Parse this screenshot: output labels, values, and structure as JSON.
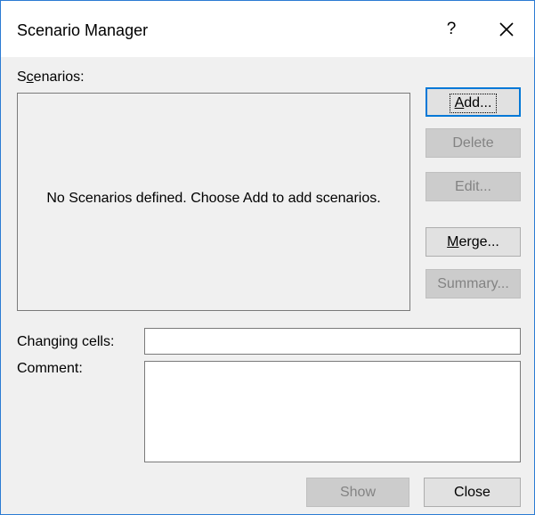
{
  "window": {
    "title": "Scenario Manager",
    "help_label": "?",
    "close_icon": "close-icon"
  },
  "scenarios": {
    "label_before": "S",
    "label_mnemonic": "c",
    "label_after": "enarios:",
    "empty_message": "No Scenarios defined. Choose Add to add scenarios."
  },
  "buttons": {
    "add": {
      "mnemonic": "A",
      "rest": "dd...",
      "enabled": true
    },
    "delete": {
      "label": "Delete",
      "enabled": false
    },
    "edit": {
      "label": "Edit...",
      "enabled": false
    },
    "merge": {
      "mnemonic": "M",
      "rest": "erge...",
      "enabled": true
    },
    "summary": {
      "label": "Summary...",
      "enabled": false
    },
    "show": {
      "label": "Show",
      "enabled": false
    },
    "close": {
      "label": "Close",
      "enabled": true
    }
  },
  "fields": {
    "changing_cells_label": "Changing cells:",
    "changing_cells_value": "",
    "comment_label": "Comment:",
    "comment_value": ""
  },
  "colors": {
    "accent": "#0078d7",
    "window_border": "#2b7bd3",
    "dialog_background": "#f0f0f0",
    "disabled_text": "#838383"
  }
}
